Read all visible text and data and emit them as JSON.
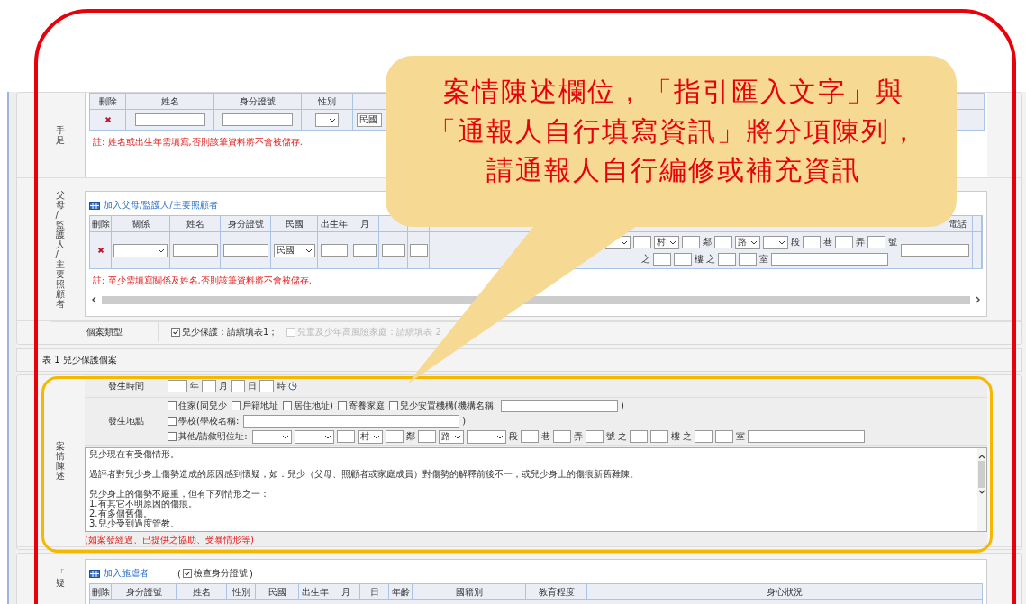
{
  "callout": {
    "text": "案情陳述欄位，「指引匯入文字」與「通報人自行填寫資訊」將分項陳列，請通報人自行編修或補充資訊"
  },
  "siblings": {
    "label": "手足",
    "columns": [
      "刪除",
      "姓名",
      "身分證號",
      "性別"
    ],
    "era": "民國",
    "note": "註: 姓名或出生年需填寫,否則該筆資料將不會被儲存."
  },
  "guardians": {
    "label": "父母/監護人/主要照顧者",
    "add_link": "加入父母/監護人/主要照顧者",
    "columns": [
      "刪除",
      "關係",
      "姓名",
      "身分證號",
      "民國",
      "出生年",
      "月"
    ],
    "phone_column": "電話",
    "era": "民國",
    "address_lines": [
      [
        {
          "kind": "select"
        },
        {
          "kind": "input"
        },
        {
          "kind": "select",
          "text": "村"
        },
        {
          "kind": "input"
        },
        {
          "kind": "label",
          "text": "鄰"
        },
        {
          "kind": "input"
        },
        {
          "kind": "select",
          "text": "路"
        },
        {
          "kind": "select"
        },
        {
          "kind": "label",
          "text": "段"
        },
        {
          "kind": "input"
        },
        {
          "kind": "label",
          "text": "巷"
        },
        {
          "kind": "input"
        },
        {
          "kind": "label",
          "text": "弄"
        },
        {
          "kind": "input"
        },
        {
          "kind": "label",
          "text": "號"
        }
      ],
      [
        {
          "kind": "label",
          "text": "之"
        },
        {
          "kind": "input"
        },
        {
          "kind": "input"
        },
        {
          "kind": "label",
          "text": "樓"
        },
        {
          "kind": "label",
          "text": "之"
        },
        {
          "kind": "input"
        },
        {
          "kind": "input"
        },
        {
          "kind": "label",
          "text": "室"
        },
        {
          "kind": "wide-input"
        }
      ]
    ],
    "note": "註: 至少需填寫關係及姓名,否則該筆資料將不會被儲存."
  },
  "case_type": {
    "label": "個案類型",
    "options": [
      {
        "text": "兒少保護：請續填表1；",
        "checked": true,
        "disabled": false
      },
      {
        "text": "兒童及少年高風險家庭：請續填表 2",
        "checked": false,
        "disabled": true
      }
    ]
  },
  "table1_heading": "表 1 兒少保護個案",
  "incident": {
    "label": "案情陳述",
    "time": {
      "label": "發生時間",
      "units": [
        "年",
        "月",
        "日",
        "時"
      ]
    },
    "place": {
      "label": "發生地點",
      "lines": [
        [
          {
            "kind": "checkbox",
            "text": "住家(同兒少",
            "checked": false
          },
          {
            "kind": "checkbox",
            "text": "戶籍地址",
            "checked": false
          },
          {
            "kind": "checkbox",
            "text": "居住地址)",
            "checked": false
          },
          {
            "kind": "checkbox",
            "text": "寄養家庭",
            "checked": false
          },
          {
            "kind": "checkbox",
            "text": "兒少安置機構(機構名稱:",
            "checked": false
          },
          {
            "kind": "wide-input"
          },
          {
            "kind": "label",
            "text": ")"
          }
        ],
        [
          {
            "kind": "checkbox",
            "text": "學校(學校名稱:",
            "checked": false
          },
          {
            "kind": "long-input"
          },
          {
            "kind": "label",
            "text": ")"
          }
        ],
        [
          {
            "kind": "checkbox",
            "text": "其他/請敘明位址:",
            "checked": false
          },
          {
            "kind": "select"
          },
          {
            "kind": "select"
          },
          {
            "kind": "input"
          },
          {
            "kind": "select",
            "text": "村"
          },
          {
            "kind": "input"
          },
          {
            "kind": "label",
            "text": "鄰"
          },
          {
            "kind": "input"
          },
          {
            "kind": "select",
            "text": "路"
          },
          {
            "kind": "select"
          },
          {
            "kind": "label",
            "text": "段"
          },
          {
            "kind": "input"
          },
          {
            "kind": "label",
            "text": "巷"
          },
          {
            "kind": "input"
          },
          {
            "kind": "label",
            "text": "弄"
          },
          {
            "kind": "input"
          },
          {
            "kind": "label",
            "text": "號"
          },
          {
            "kind": "label",
            "text": "之"
          },
          {
            "kind": "input"
          },
          {
            "kind": "input"
          },
          {
            "kind": "label",
            "text": "樓"
          },
          {
            "kind": "label",
            "text": "之"
          },
          {
            "kind": "input"
          },
          {
            "kind": "input"
          },
          {
            "kind": "label",
            "text": "室"
          },
          {
            "kind": "wide-input"
          }
        ]
      ]
    },
    "description": [
      [
        "兒少現在有受傷情形。"
      ],
      [
        "過評者對兒少身上傷勢造成的原因感到懷疑，如：兒少（父母、照顧者或家庭成員）對傷勢的解釋前後不一；或兒少身上的傷痕新舊雜陳。"
      ],
      [
        "兒少身上的傷勢不嚴重，但有下列情形之一：",
        "1.有其它不明原因的傷痕。",
        "2.有多個舊傷。",
        "3.兒少受到過度管教。"
      ]
    ],
    "hint": "(如案發經過、已提供之協助、受暴情形等)"
  },
  "perpetrators": {
    "label": "「疑",
    "add_link": "加入施虐者",
    "check_id": {
      "open": "(",
      "text": "檢查身分證號",
      "checked": true,
      "close": ")"
    },
    "columns": [
      "刪除",
      "身分證號",
      "姓名",
      "性別",
      "民國",
      "出生年",
      "月",
      "日",
      "年齡",
      "國籍別",
      "教育程度",
      "身心狀況"
    ]
  }
}
